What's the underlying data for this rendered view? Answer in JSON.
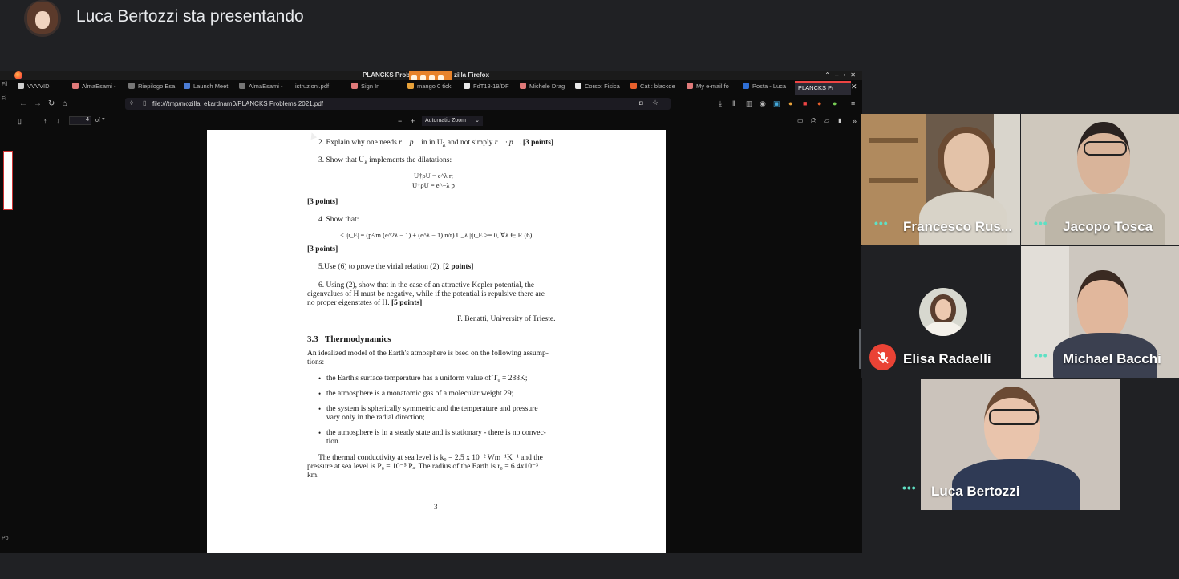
{
  "header": {
    "presenting_title": "Luca Bertozzi sta presentando"
  },
  "browser": {
    "window_title": "PLANCKS Probl",
    "window_title_tail": "zilla Firefox",
    "tabs": [
      {
        "label": "VVVVID",
        "icon": "tab-favicon",
        "color": "#cfcfcf"
      },
      {
        "label": "AlmaEsami -",
        "icon": "tab-favicon",
        "color": "#e07a7a"
      },
      {
        "label": "Riepilogo Esa",
        "icon": "tab-favicon",
        "color": "#777777"
      },
      {
        "label": "Launch Meet",
        "icon": "tab-favicon",
        "color": "#4a7bd4"
      },
      {
        "label": "AlmaEsami -",
        "icon": "tab-favicon",
        "color": "#777777"
      },
      {
        "label": "istruzioni.pdf",
        "icon": "tab-favicon",
        "color": "#0c0c0c"
      },
      {
        "label": "Sign In",
        "icon": "tab-favicon",
        "color": "#e07a7a"
      },
      {
        "label": "mango 0 tick",
        "icon": "tab-favicon",
        "color": "#e8a23a"
      },
      {
        "label": "FdT18-19/DF",
        "icon": "tab-favicon",
        "color": "#e8e8e8"
      },
      {
        "label": "Michele Drag",
        "icon": "tab-favicon",
        "color": "#e07a7a"
      },
      {
        "label": "Corso: Fisica",
        "icon": "tab-favicon",
        "color": "#e8e8e8"
      },
      {
        "label": "Cat : blackde",
        "icon": "tab-favicon",
        "color": "#e8602c"
      },
      {
        "label": "My e-mail fo",
        "icon": "tab-favicon",
        "color": "#e07a7a"
      },
      {
        "label": "Posta - Luca",
        "icon": "tab-favicon",
        "color": "#2f6fd6"
      },
      {
        "label": "PLANCKS Pr",
        "icon": "tab-favicon",
        "color": "#0c0c0c",
        "active": true
      }
    ],
    "url": "file:///tmp/mozilla_ekardnam0/PLANCKS Problems 2021.pdf",
    "left_sidebar": [
      "Fil",
      "Fi",
      "Po"
    ]
  },
  "pdf_viewer": {
    "page_number": "4",
    "page_total": "of 7",
    "zoom": "Automatic Zoom",
    "zoom_out": "−",
    "zoom_in": "+"
  },
  "pdf_content": {
    "q2": "2. Explain why one needs",
    "q2_tail": "in U",
    "q2_tail2": "and not simply",
    "q2_points": "[3 points]",
    "q3": "3. Show that U",
    "q3_tail": "implements the dilatations:",
    "eq1": "U†ρU = e^λ r;",
    "eq2": "U†ρU = e^−λ p",
    "p3": "[3 points]",
    "q4": "4. Show that:",
    "eq3": "< ψ_E| = (p²/m (e^2λ − 1) + (e^λ − 1) n/r) U_λ |ψ_E >= 0, ∀λ ∈ R  (6)",
    "p4": "[3 points]",
    "q5": "5.Use (6) to prove the virial relation (2).",
    "q5_points": "[2 points]",
    "q6_l1": "6.  Using (2), show that in the case of an attractive Kepler potential, the",
    "q6_l2": "eigenvalues of H must be negative, while if the potential is repulsive there are",
    "q6_l3": "no proper eigenstates of H.",
    "q6_points": "[5 points]",
    "author": "F. Benatti, University of Trieste.",
    "section_number": "3.3",
    "section_title": "Thermodynamics",
    "intro_l1": "An idealized model of the Earth's atmosphere is bsed on the following assump-",
    "intro_l2": "tions:",
    "bullet1": "the Earth's surface temperature has a uniform value of T₀ = 288K;",
    "bullet2": "the atmosphere is a monatomic gas of a molecular weight 29;",
    "bullet3_l1": "the system is spherically symmetric and the temperature and pressure",
    "bullet3_l2": "vary only in the radial direction;",
    "bullet4_l1": "the atmosphere is in a steady state and is stationary - there is no convec-",
    "bullet4_l2": "tion.",
    "end_l1": "The thermal conductivity at sea level is k₀ = 2.5 x 10⁻² Wm⁻¹K⁻¹ and the",
    "end_l2": "pressure at sea level is P₀ = 10⁻⁵ Pₐ.  The radius of the Earth is r₀ = 6.4x10⁻³",
    "end_l3": "km.",
    "page_footer": "3"
  },
  "participants": [
    {
      "name": "Francesco Rus...",
      "muted": false
    },
    {
      "name": "Jacopo Tosca",
      "muted": false
    },
    {
      "name": "Elisa Radaelli",
      "muted": true
    },
    {
      "name": "Michael Bacchi",
      "muted": false
    },
    {
      "name": "Luca Bertozzi",
      "muted": false
    }
  ],
  "colors": {
    "meet_background": "#202124",
    "speaking_indicator": "#5fe0c4",
    "muted_red": "#ea4335",
    "share_indicator": "#e8832a"
  }
}
